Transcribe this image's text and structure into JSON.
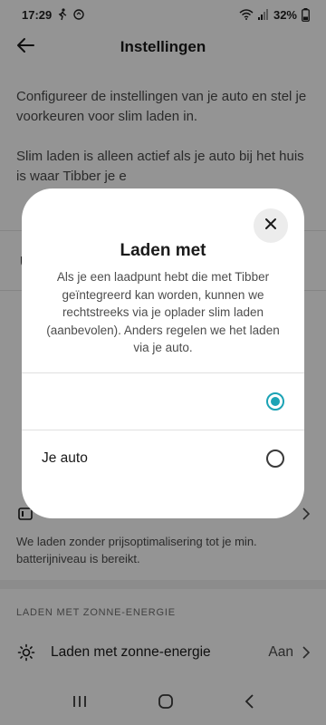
{
  "status_bar": {
    "time": "17:29",
    "battery": "32%",
    "icons": [
      "walking-icon",
      "assistant-icon",
      "wifi-icon",
      "signal-icon",
      "battery-icon"
    ]
  },
  "app_bar": {
    "title": "Instellingen",
    "back_icon": "arrow-left-icon"
  },
  "intro": {
    "paragraph1": "Configureer de instellingen van je auto en stel je voorkeuren voor slim laden in.",
    "paragraph2": "Slim laden is alleen actief als je auto bij het huis is waar Tibber je e"
  },
  "background": {
    "row_partial_label": "",
    "row2_subtitle": "We laden zonder prijsoptimalisering tot je min. batterijniveau is bereikt.",
    "section_solar": "LADEN MET ZONNE-ENERGIE",
    "solar_row": {
      "label": "Laden met zonne-energie",
      "value": "Aan",
      "icon": "sun-icon"
    }
  },
  "dialog": {
    "title": "Laden met",
    "body": "Als je een laadpunt hebt die met Tibber geïntegreerd kan worden, kunnen we rechtstreeks via je oplader slim laden (aanbevolen). Anders regelen we het laden via je auto.",
    "close_icon": "close-icon",
    "options": [
      {
        "label": "",
        "selected": true
      },
      {
        "label": "Je auto",
        "selected": false
      }
    ],
    "accent_color": "#1ba3b5"
  },
  "nav_bar": {
    "icons": [
      "recents-icon",
      "home-icon",
      "back-icon"
    ]
  }
}
